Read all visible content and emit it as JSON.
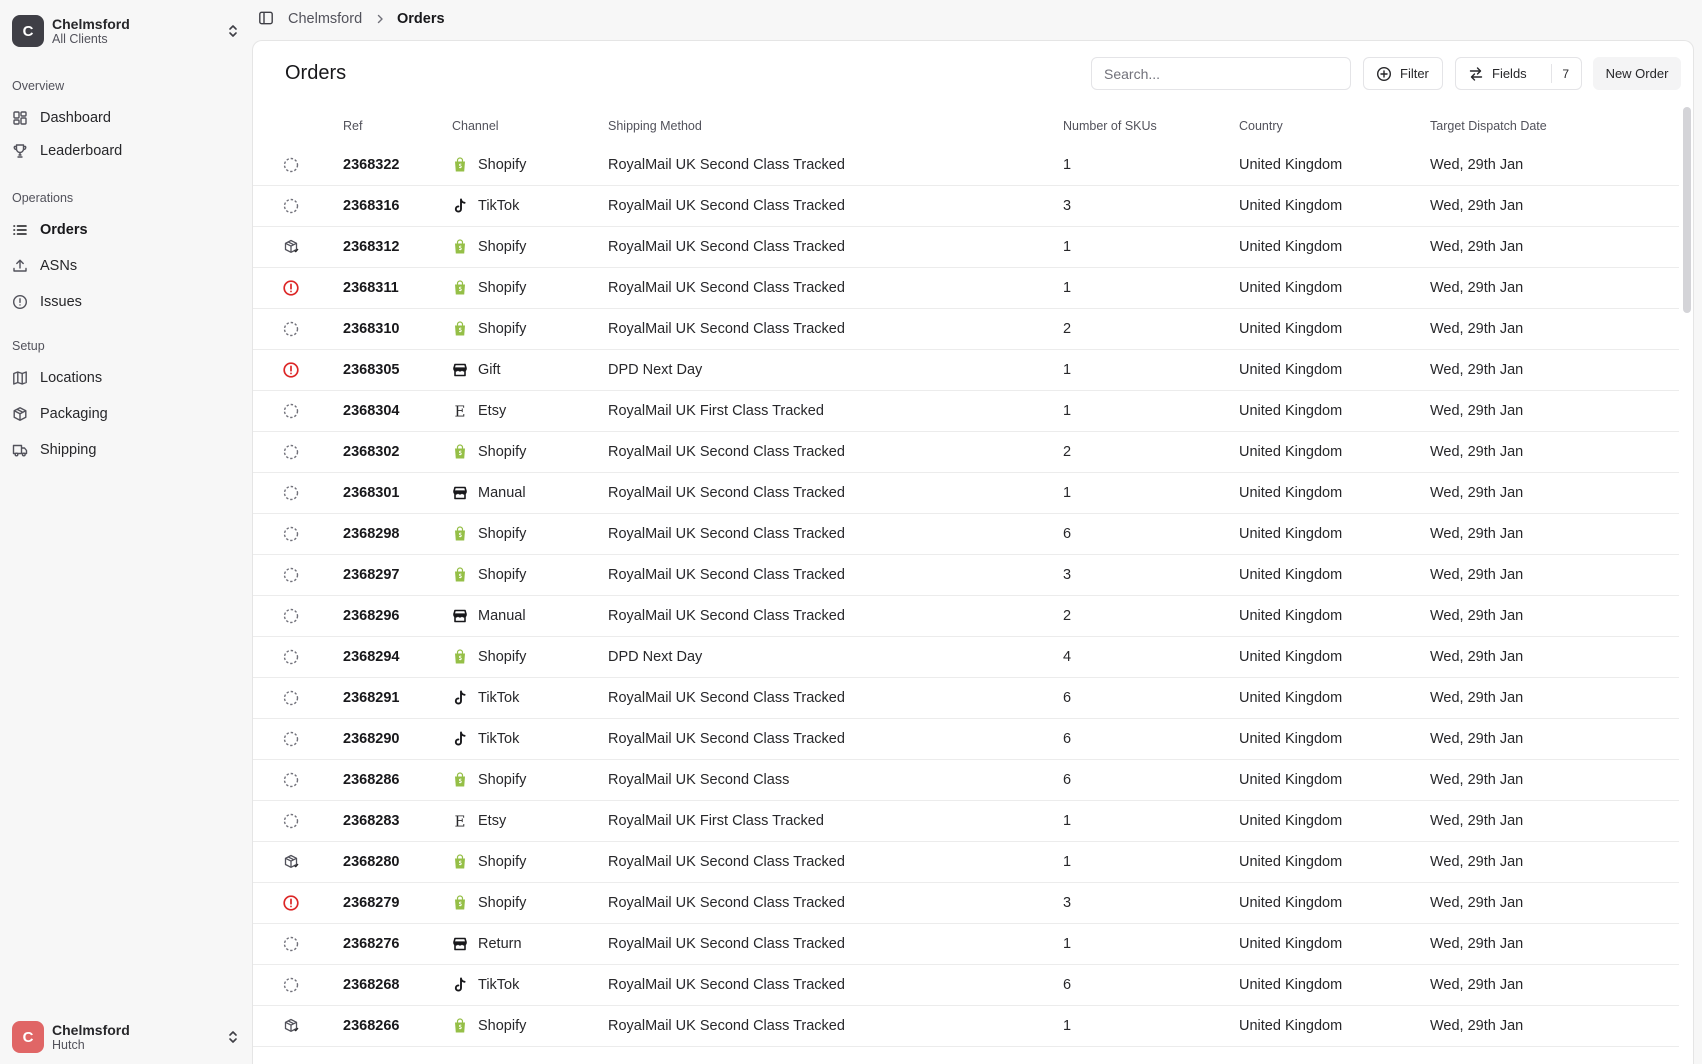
{
  "workspace": {
    "initial": "C",
    "name": "Chelmsford",
    "sub": "All Clients"
  },
  "user": {
    "initial": "C",
    "name": "Chelmsford",
    "sub": "Hutch"
  },
  "nav": {
    "groups": [
      {
        "label": "Overview",
        "items": [
          {
            "label": "Dashboard",
            "icon": "dashboard-icon"
          },
          {
            "label": "Leaderboard",
            "icon": "trophy-icon"
          }
        ]
      },
      {
        "label": "Operations",
        "items": [
          {
            "label": "Orders",
            "icon": "list-icon",
            "active": true
          },
          {
            "label": "ASNs",
            "icon": "upload-icon"
          },
          {
            "label": "Issues",
            "icon": "alert-circle-icon"
          }
        ]
      },
      {
        "label": "Setup",
        "items": [
          {
            "label": "Locations",
            "icon": "map-icon"
          },
          {
            "label": "Packaging",
            "icon": "package-icon"
          },
          {
            "label": "Shipping",
            "icon": "truck-icon"
          }
        ]
      }
    ]
  },
  "breadcrumb": {
    "root": "Chelmsford",
    "current": "Orders"
  },
  "page": {
    "title": "Orders",
    "search_placeholder": "Search...",
    "filter_label": "Filter",
    "fields_label": "Fields",
    "fields_count": "7",
    "new_order_label": "New Order"
  },
  "table": {
    "columns": {
      "ref": "Ref",
      "channel": "Channel",
      "shipping": "Shipping Method",
      "skus": "Number of SKUs",
      "country": "Country",
      "date": "Target Dispatch Date"
    },
    "rows": [
      {
        "status": "pending",
        "ref": "2368322",
        "channel": "Shopify",
        "shipping": "RoyalMail UK Second Class Tracked",
        "skus": "1",
        "country": "United Kingdom",
        "date": "Wed, 29th Jan"
      },
      {
        "status": "pending",
        "ref": "2368316",
        "channel": "TikTok",
        "shipping": "RoyalMail UK Second Class Tracked",
        "skus": "3",
        "country": "United Kingdom",
        "date": "Wed, 29th Jan"
      },
      {
        "status": "packed",
        "ref": "2368312",
        "channel": "Shopify",
        "shipping": "RoyalMail UK Second Class Tracked",
        "skus": "1",
        "country": "United Kingdom",
        "date": "Wed, 29th Jan"
      },
      {
        "status": "issue",
        "ref": "2368311",
        "channel": "Shopify",
        "shipping": "RoyalMail UK Second Class Tracked",
        "skus": "1",
        "country": "United Kingdom",
        "date": "Wed, 29th Jan"
      },
      {
        "status": "pending",
        "ref": "2368310",
        "channel": "Shopify",
        "shipping": "RoyalMail UK Second Class Tracked",
        "skus": "2",
        "country": "United Kingdom",
        "date": "Wed, 29th Jan"
      },
      {
        "status": "issue",
        "ref": "2368305",
        "channel": "Gift",
        "shipping": "DPD Next Day",
        "skus": "1",
        "country": "United Kingdom",
        "date": "Wed, 29th Jan"
      },
      {
        "status": "pending",
        "ref": "2368304",
        "channel": "Etsy",
        "shipping": "RoyalMail UK First Class Tracked",
        "skus": "1",
        "country": "United Kingdom",
        "date": "Wed, 29th Jan"
      },
      {
        "status": "pending",
        "ref": "2368302",
        "channel": "Shopify",
        "shipping": "RoyalMail UK Second Class Tracked",
        "skus": "2",
        "country": "United Kingdom",
        "date": "Wed, 29th Jan"
      },
      {
        "status": "pending",
        "ref": "2368301",
        "channel": "Manual",
        "shipping": "RoyalMail UK Second Class Tracked",
        "skus": "1",
        "country": "United Kingdom",
        "date": "Wed, 29th Jan"
      },
      {
        "status": "pending",
        "ref": "2368298",
        "channel": "Shopify",
        "shipping": "RoyalMail UK Second Class Tracked",
        "skus": "6",
        "country": "United Kingdom",
        "date": "Wed, 29th Jan"
      },
      {
        "status": "pending",
        "ref": "2368297",
        "channel": "Shopify",
        "shipping": "RoyalMail UK Second Class Tracked",
        "skus": "3",
        "country": "United Kingdom",
        "date": "Wed, 29th Jan"
      },
      {
        "status": "pending",
        "ref": "2368296",
        "channel": "Manual",
        "shipping": "RoyalMail UK Second Class Tracked",
        "skus": "2",
        "country": "United Kingdom",
        "date": "Wed, 29th Jan"
      },
      {
        "status": "pending",
        "ref": "2368294",
        "channel": "Shopify",
        "shipping": "DPD Next Day",
        "skus": "4",
        "country": "United Kingdom",
        "date": "Wed, 29th Jan"
      },
      {
        "status": "pending",
        "ref": "2368291",
        "channel": "TikTok",
        "shipping": "RoyalMail UK Second Class Tracked",
        "skus": "6",
        "country": "United Kingdom",
        "date": "Wed, 29th Jan"
      },
      {
        "status": "pending",
        "ref": "2368290",
        "channel": "TikTok",
        "shipping": "RoyalMail UK Second Class Tracked",
        "skus": "6",
        "country": "United Kingdom",
        "date": "Wed, 29th Jan"
      },
      {
        "status": "pending",
        "ref": "2368286",
        "channel": "Shopify",
        "shipping": "RoyalMail UK Second Class",
        "skus": "6",
        "country": "United Kingdom",
        "date": "Wed, 29th Jan"
      },
      {
        "status": "pending",
        "ref": "2368283",
        "channel": "Etsy",
        "shipping": "RoyalMail UK First Class Tracked",
        "skus": "1",
        "country": "United Kingdom",
        "date": "Wed, 29th Jan"
      },
      {
        "status": "packed",
        "ref": "2368280",
        "channel": "Shopify",
        "shipping": "RoyalMail UK Second Class Tracked",
        "skus": "1",
        "country": "United Kingdom",
        "date": "Wed, 29th Jan"
      },
      {
        "status": "issue",
        "ref": "2368279",
        "channel": "Shopify",
        "shipping": "RoyalMail UK Second Class Tracked",
        "skus": "3",
        "country": "United Kingdom",
        "date": "Wed, 29th Jan"
      },
      {
        "status": "pending",
        "ref": "2368276",
        "channel": "Return",
        "shipping": "RoyalMail UK Second Class Tracked",
        "skus": "1",
        "country": "United Kingdom",
        "date": "Wed, 29th Jan"
      },
      {
        "status": "pending",
        "ref": "2368268",
        "channel": "TikTok",
        "shipping": "RoyalMail UK Second Class Tracked",
        "skus": "6",
        "country": "United Kingdom",
        "date": "Wed, 29th Jan"
      },
      {
        "status": "packed",
        "ref": "2368266",
        "channel": "Shopify",
        "shipping": "RoyalMail UK Second Class Tracked",
        "skus": "1",
        "country": "United Kingdom",
        "date": "Wed, 29th Jan"
      }
    ]
  },
  "colors": {
    "issue": "#dc2626",
    "shopify": "#95bf47",
    "muted": "#71717a"
  }
}
